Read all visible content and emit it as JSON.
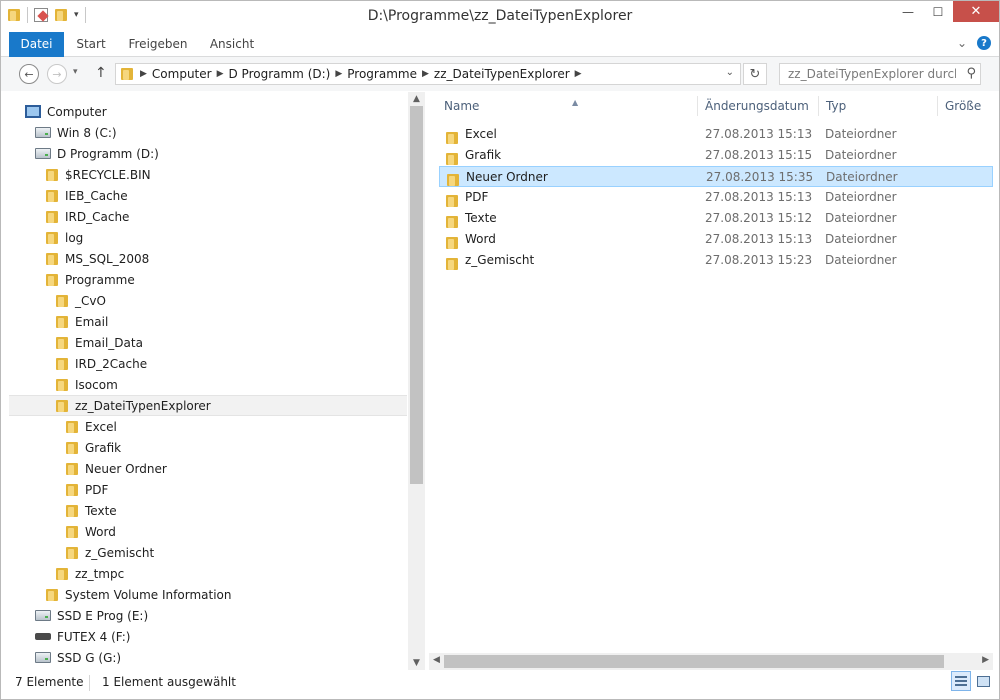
{
  "window": {
    "title": "D:\\Programme\\zz_DateiTypenExplorer",
    "minimize_glyph": "—",
    "maximize_glyph": "☐",
    "close_glyph": "✕"
  },
  "ribbon": {
    "tabs": [
      {
        "label": "Datei",
        "active": true
      },
      {
        "label": "Start"
      },
      {
        "label": "Freigeben"
      },
      {
        "label": "Ansicht"
      }
    ],
    "expand_glyph": "⌄",
    "help_glyph": "?"
  },
  "address": {
    "back_glyph": "←",
    "forward_glyph": "→",
    "up_glyph": "↑",
    "crumbs": [
      "Computer",
      "D Programm (D:)",
      "Programme",
      "zz_DateiTypenExplorer"
    ],
    "refresh_glyph": "↻",
    "search_placeholder": "zz_DateiTypenExplorer durchs...",
    "search_glyph": "⚲"
  },
  "nav_tree": [
    {
      "label": "Computer",
      "icon": "computer-icon",
      "indent": 0
    },
    {
      "label": "Win 8 (C:)",
      "icon": "drive-icon",
      "indent": 1
    },
    {
      "label": "D Programm (D:)",
      "icon": "drive-icon",
      "indent": 1
    },
    {
      "label": "$RECYCLE.BIN",
      "icon": "folder-icon",
      "indent": 2
    },
    {
      "label": "IEB_Cache",
      "icon": "folder-icon",
      "indent": 2
    },
    {
      "label": "IRD_Cache",
      "icon": "folder-icon",
      "indent": 2
    },
    {
      "label": "log",
      "icon": "folder-icon",
      "indent": 2
    },
    {
      "label": "MS_SQL_2008",
      "icon": "folder-icon",
      "indent": 2
    },
    {
      "label": "Programme",
      "icon": "folder-icon",
      "indent": 2
    },
    {
      "label": "_CvO",
      "icon": "folder-icon",
      "indent": 3
    },
    {
      "label": "Email",
      "icon": "folder-icon",
      "indent": 3
    },
    {
      "label": "Email_Data",
      "icon": "folder-icon",
      "indent": 3
    },
    {
      "label": "IRD_2Cache",
      "icon": "folder-icon",
      "indent": 3
    },
    {
      "label": "Isocom",
      "icon": "folder-icon",
      "indent": 3
    },
    {
      "label": "zz_DateiTypenExplorer",
      "icon": "folder-icon",
      "indent": 3,
      "selected": true
    },
    {
      "label": "Excel",
      "icon": "folder-icon",
      "indent": 4
    },
    {
      "label": "Grafik",
      "icon": "folder-icon",
      "indent": 4
    },
    {
      "label": "Neuer Ordner",
      "icon": "folder-icon",
      "indent": 4
    },
    {
      "label": "PDF",
      "icon": "folder-icon",
      "indent": 4
    },
    {
      "label": "Texte",
      "icon": "folder-icon",
      "indent": 4
    },
    {
      "label": "Word",
      "icon": "folder-icon",
      "indent": 4
    },
    {
      "label": "z_Gemischt",
      "icon": "folder-icon",
      "indent": 4
    },
    {
      "label": "zz_tmpc",
      "icon": "folder-icon",
      "indent": 3
    },
    {
      "label": "System Volume Information",
      "icon": "folder-icon",
      "indent": 2
    },
    {
      "label": "SSD E Prog (E:)",
      "icon": "drive-icon",
      "indent": 1
    },
    {
      "label": "FUTEX 4 (F:)",
      "icon": "usb-icon",
      "indent": 1
    },
    {
      "label": "SSD G (G:)",
      "icon": "drive-icon",
      "indent": 1
    }
  ],
  "columns": {
    "name": "Name",
    "date": "Änderungsdatum",
    "type": "Typ",
    "size": "Größe",
    "sort_glyph": "▲"
  },
  "files": [
    {
      "name": "Excel",
      "date": "27.08.2013 15:13",
      "type": "Dateiordner"
    },
    {
      "name": "Grafik",
      "date": "27.08.2013 15:15",
      "type": "Dateiordner"
    },
    {
      "name": "Neuer Ordner",
      "date": "27.08.2013 15:35",
      "type": "Dateiordner",
      "selected": true
    },
    {
      "name": "PDF",
      "date": "27.08.2013 15:13",
      "type": "Dateiordner"
    },
    {
      "name": "Texte",
      "date": "27.08.2013 15:12",
      "type": "Dateiordner"
    },
    {
      "name": "Word",
      "date": "27.08.2013 15:13",
      "type": "Dateiordner"
    },
    {
      "name": "z_Gemischt",
      "date": "27.08.2013 15:23",
      "type": "Dateiordner"
    }
  ],
  "scroll": {
    "up_glyph": "▲",
    "down_glyph": "▼",
    "left_glyph": "◀",
    "right_glyph": "▶"
  },
  "status": {
    "count": "7 Elemente",
    "selection": "1 Element ausgewählt"
  },
  "colors": {
    "accent": "#1979ca",
    "selection_bg": "#cce8ff",
    "selection_border": "#99d1ff",
    "close_button": "#c7504a",
    "folder": "#e3b438"
  }
}
